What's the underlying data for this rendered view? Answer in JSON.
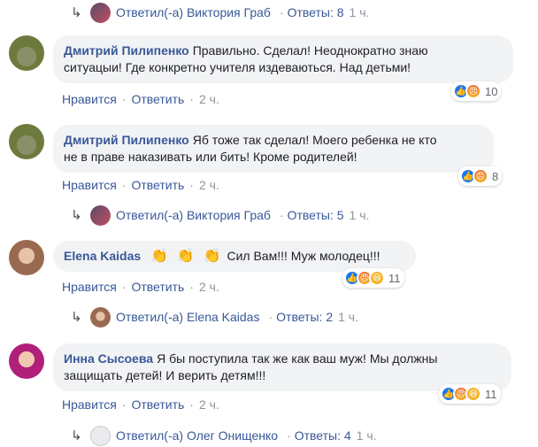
{
  "reply_top": {
    "text": "Ответил(-а) Виктория Граб",
    "replies": "Ответы: 8",
    "time": "1 ч."
  },
  "comments": [
    {
      "author": "Дмитрий Пилипенко",
      "line1": "Правильно. Сделал! Неоднократно знаю",
      "line2": "ситуацыи! Где конкретно учителя издеваються. Над детьми!",
      "like": "Нравится",
      "reply": "Ответить",
      "time": "2 ч.",
      "reactions": [
        "like-icon",
        "angry-icon"
      ],
      "count": "10"
    },
    {
      "author": "Дмитрий Пилипенко",
      "line1": "Яб тоже так сделал! Моего ребенка не кто",
      "line2": "не в праве наказивать или бить! Кроме родителей!",
      "like": "Нравится",
      "reply": "Ответить",
      "time": "2 ч.",
      "reactions": [
        "like-icon",
        "angry-icon"
      ],
      "count": "8",
      "reply_row": {
        "text": "Ответил(-а) Виктория Граб",
        "replies": "Ответы: 5",
        "time": "1 ч."
      }
    },
    {
      "author": "Elena Kaidas",
      "line1": "Сил Вам!!! Муж молодец!!!",
      "like": "Нравится",
      "reply": "Ответить",
      "time": "2 ч.",
      "reactions": [
        "like-icon",
        "angry-icon",
        "haha-icon"
      ],
      "count": "11",
      "reply_row": {
        "text": "Ответил(-а) Elena Kaidas",
        "replies": "Ответы: 2",
        "time": "1 ч."
      }
    },
    {
      "author": "Инна Сысоева",
      "line1": "Я бы поступила так же как ваш муж! Мы должны",
      "line2": "защищать детей! И верить детям!!!",
      "like": "Нравится",
      "reply": "Ответить",
      "time": "2 ч.",
      "reactions": [
        "like-icon",
        "angry-icon",
        "haha-icon"
      ],
      "count": "11",
      "reply_row": {
        "text": "Ответил(-а) Олег Онищенко",
        "replies": "Ответы: 4",
        "time": "1 ч."
      }
    }
  ],
  "colors": {
    "link": "#385898",
    "bubble": "#f2f3f5",
    "meta": "#90949c"
  }
}
